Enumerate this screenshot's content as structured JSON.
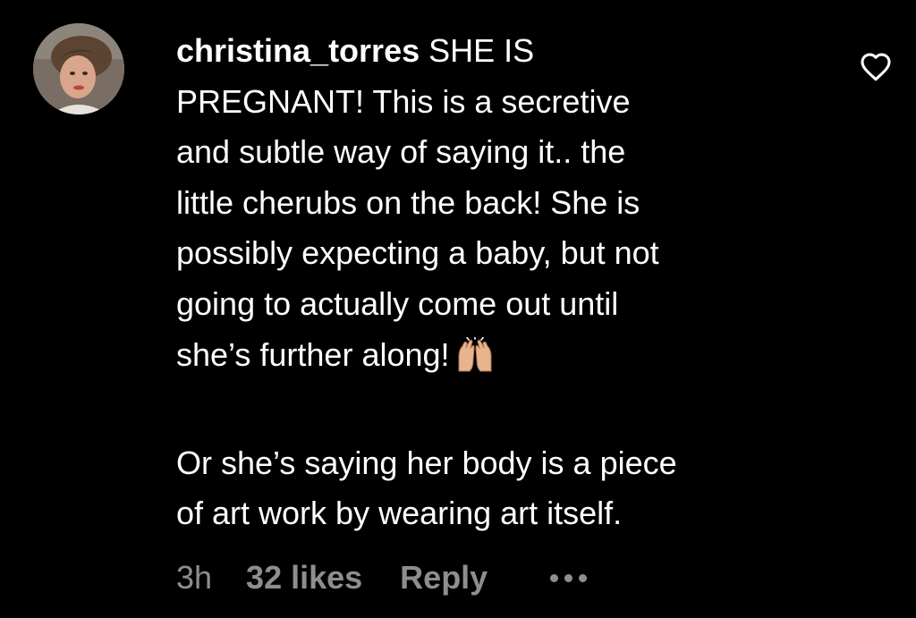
{
  "comment": {
    "username": "christina_torres",
    "lines": [
      " SHE IS",
      "PREGNANT! This is a secretive",
      "and subtle way of saying it.. the",
      "little cherubs on the back! She is",
      "possibly expecting a baby, but not",
      "going to actually come out until",
      "she’s further along!"
    ],
    "emoji": "raising-hands-emoji",
    "paragraph2_lines": [
      "Or she’s saying her body is a piece",
      "of art work by wearing art itself."
    ]
  },
  "meta": {
    "time": "3h",
    "likes": "32 likes",
    "reply": "Reply"
  },
  "icons": {
    "like": "heart-outline-icon",
    "more": "more-options-icon"
  },
  "colors": {
    "background": "#000000",
    "text": "#ffffff",
    "secondary_text": "#8e8e8e"
  }
}
